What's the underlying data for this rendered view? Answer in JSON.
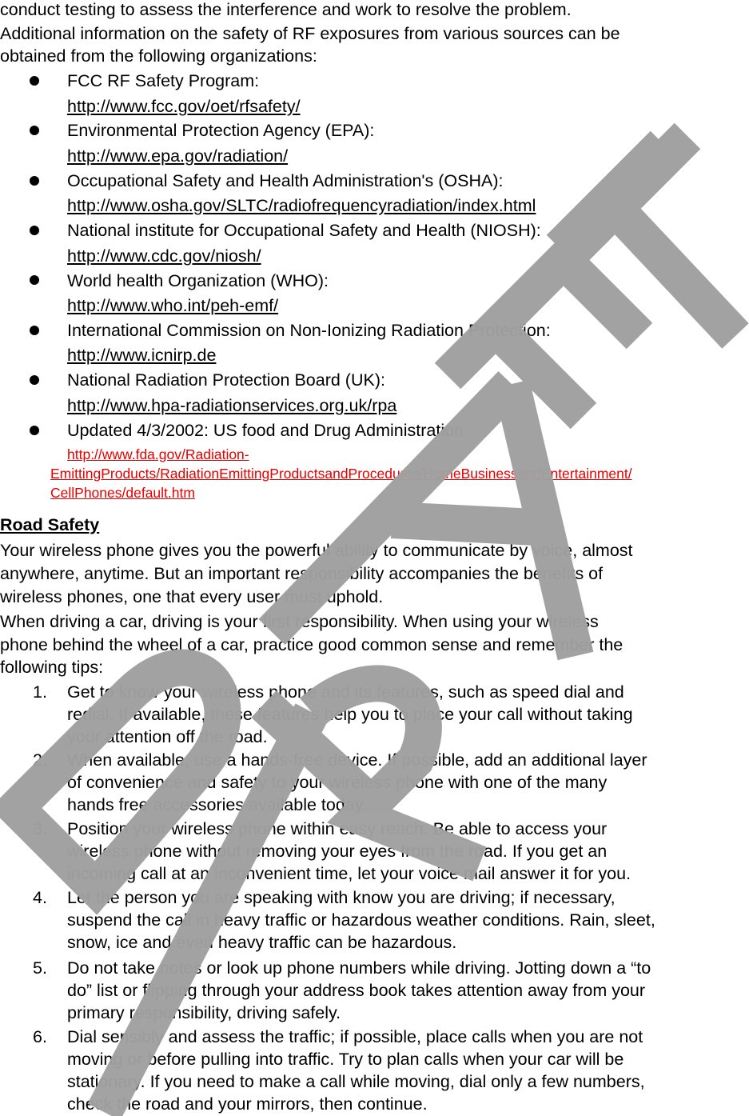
{
  "intro": {
    "line1": "conduct testing to assess the interference and work to resolve the problem.",
    "line2": "Additional information on the safety of RF exposures from various sources can be",
    "line3": "obtained from the following organizations:"
  },
  "organizations": [
    {
      "name": "FCC RF Safety Program:",
      "url": "http://www.fcc.gov/oet/rfsafety/"
    },
    {
      "name": "Environmental Protection Agency (EPA):",
      "url": "http://www.epa.gov/radiation/"
    },
    {
      "name": "Occupational Safety and Health Administration's (OSHA):",
      "url": "http://www.osha.gov/SLTC/radiofrequencyradiation/index.html"
    },
    {
      "name": "National institute for Occupational Safety and Health (NIOSH):",
      "url": "http://www.cdc.gov/niosh/ "
    },
    {
      "name": "World health Organization (WHO):",
      "url": "http://www.who.int/peh-emf/"
    },
    {
      "name": "International Commission on Non-Ionizing Radiation Protection:",
      "url": "http://www.icnirp.de"
    },
    {
      "name": "National Radiation Protection Board (UK):",
      "url": "http://www.hpa-radiationservices.org.uk/rpa"
    },
    {
      "name": "Updated 4/3/2002: US food and Drug Administration",
      "url_lines": [
        "http://www.fda.gov/Radiation-",
        "EmittingProducts/RadiationEmittingProductsandProcedures/HomeBusinessandEntertainment/",
        "CellPhones/default.htm"
      ]
    }
  ],
  "road_safety": {
    "heading": "Road Safety",
    "para1": [
      "Your wireless phone gives you the powerful ability to communicate by voice, almost",
      "anywhere, anytime. But an important responsibility accompanies the benefits of",
      "wireless phones, one that every user must uphold."
    ],
    "para2": [
      "When driving a car, driving is your first responsibility. When using your wireless",
      "phone behind the wheel of a car, practice good common sense and remember the",
      "following tips:"
    ],
    "tips": [
      {
        "num": "1.",
        "lines": [
          "Get to know your wireless phone and its features, such as speed dial and",
          "redial. If available, these features help you to place your call without taking",
          "your attention off the road."
        ]
      },
      {
        "num": "2.",
        "lines": [
          "When available, use a hands-free device. If possible, add an additional layer",
          "of convenience and safety to your wireless phone with one of the many",
          "hands free accessories available today."
        ]
      },
      {
        "num": "3.",
        "lines": [
          "Position your wireless phone within easy reach. Be able to access your",
          "wireless phone without removing your eyes from the road. If you get an",
          "incoming call at an inconvenient time, let your voice mail answer it for you."
        ]
      },
      {
        "num": "4.",
        "lines": [
          "Let the person you are speaking with know you are driving; if necessary,",
          "suspend the call in heavy traffic or hazardous weather conditions. Rain, sleet,",
          "snow, ice and even heavy traffic can be hazardous."
        ]
      },
      {
        "num": "5.",
        "lines": [
          "Do not take notes or look up phone numbers while driving. Jotting down a “to",
          "do” list or flipping through your address book takes attention away from your",
          "primary responsibility, driving safely."
        ]
      },
      {
        "num": "6.",
        "lines": [
          "Dial sensibly and assess the traffic; if possible, place calls when you are not",
          "moving or before pulling into traffic. Try to plan calls when your car will be",
          "stationary. If you need to make a call while moving, dial only a few numbers,",
          "check the road and your mirrors, then continue."
        ]
      }
    ]
  },
  "watermark": {
    "text": "DRAFT",
    "color": "#a0a0a0"
  },
  "colors": {
    "link_red": "#e60000",
    "text": "#000000"
  }
}
